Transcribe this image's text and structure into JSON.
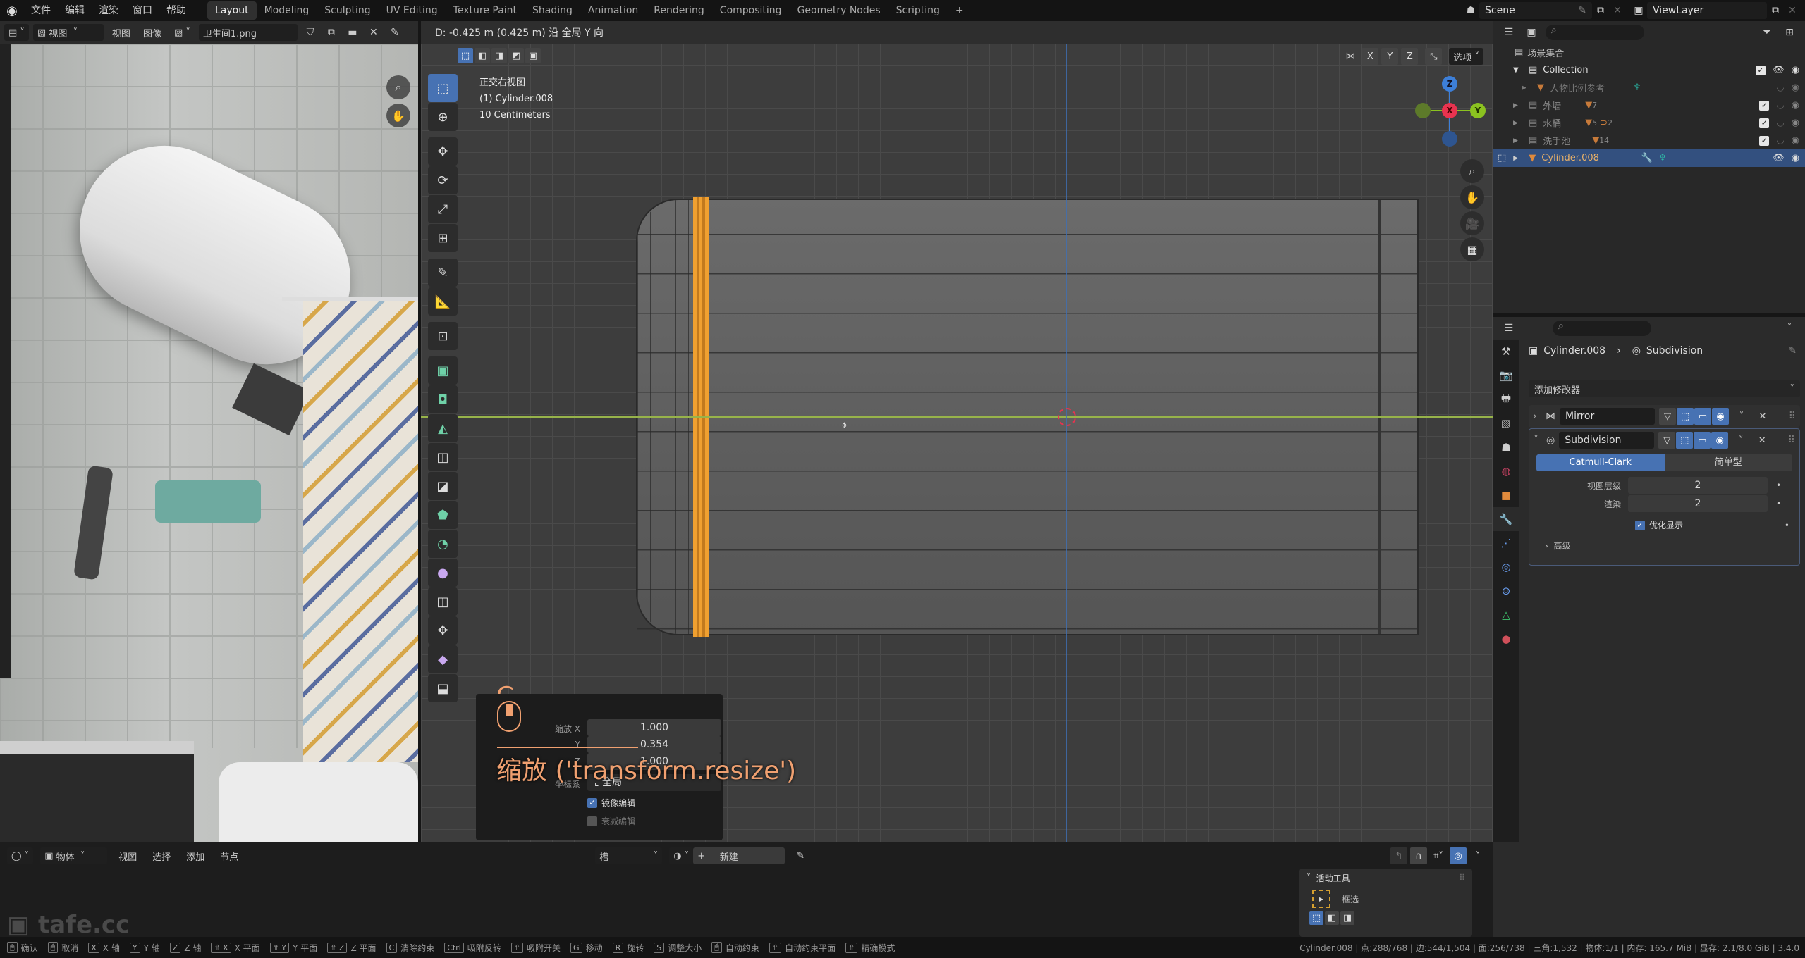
{
  "topbar": {
    "menus": [
      "文件",
      "编辑",
      "渲染",
      "窗口",
      "帮助"
    ],
    "workspaces": [
      "Layout",
      "Modeling",
      "Sculpting",
      "UV Editing",
      "Texture Paint",
      "Shading",
      "Animation",
      "Rendering",
      "Compositing",
      "Geometry Nodes",
      "Scripting"
    ],
    "active_workspace": "Layout",
    "add_workspace": "+",
    "scene": "Scene",
    "view_layer": "ViewLayer"
  },
  "image_editor": {
    "mode_label": "视图",
    "menus": [
      "视图",
      "图像"
    ],
    "image_name": "卫生间1.png"
  },
  "viewport": {
    "header_text": "D: -0.425 m (0.425 m) 沿 全局 Y 向",
    "info_lines": [
      "正交右视图",
      "(1) Cylinder.008",
      "10 Centimeters"
    ],
    "axis_toggles": [
      "X",
      "Y",
      "Z"
    ],
    "options_label": "选项",
    "gizmo": {
      "top": "Z",
      "center": "X",
      "right": "Y"
    },
    "operator": {
      "key_hint": "G",
      "caption": "缩放 ('transform.resize')",
      "fields": [
        {
          "label": "缩放 X",
          "value": "1.000"
        },
        {
          "label": "Y",
          "value": "0.354"
        },
        {
          "label": "Z",
          "value": "1.000"
        }
      ],
      "orient_label": "坐标系",
      "orient_value": "全局",
      "checkboxes": [
        {
          "label": "镜像编辑",
          "checked": true
        },
        {
          "label": "衰减编辑",
          "checked": false
        }
      ]
    }
  },
  "outliner": {
    "root": "场景集合",
    "rows": [
      {
        "name": "Collection",
        "type": "collection",
        "expanded": true
      },
      {
        "name": "人物比例参考",
        "type": "object",
        "hidden": true
      },
      {
        "name": "外墙",
        "type": "collection",
        "badge": "7"
      },
      {
        "name": "水桶",
        "type": "collection",
        "badge": "5",
        "badge2": "2"
      },
      {
        "name": "洗手池",
        "type": "collection",
        "badge": "14"
      },
      {
        "name": "Cylinder.008",
        "type": "object",
        "selected": true
      }
    ]
  },
  "properties": {
    "breadcrumb_object": "Cylinder.008",
    "breadcrumb_modifier": "Subdivision",
    "add_modifier": "添加修改器",
    "modifiers": [
      {
        "name": "Mirror",
        "expanded": false
      },
      {
        "name": "Subdivision",
        "expanded": true
      }
    ],
    "subdiv_types": [
      "Catmull-Clark",
      "简单型"
    ],
    "active_type": "Catmull-Clark",
    "levels_viewport_label": "视图层级",
    "levels_viewport": "2",
    "render_label": "渲染",
    "render_levels": "2",
    "optimal_display_label": "优化显示",
    "optimal_display": true,
    "advanced_label": "高级"
  },
  "timeline": {
    "editor_mode": "物体",
    "menus": [
      "视图",
      "选择",
      "添加",
      "节点"
    ],
    "slot_label": "槽",
    "new_label": "新建",
    "active_tool_title": "活动工具",
    "active_tool_name": "框选"
  },
  "status": {
    "hints": [
      {
        "key": "",
        "label": "确认"
      },
      {
        "key": "",
        "label": "取消"
      },
      {
        "key": "X",
        "label": "X 轴"
      },
      {
        "key": "Y",
        "label": "Y 轴"
      },
      {
        "key": "Z",
        "label": "Z 轴"
      },
      {
        "key": "⇧ X",
        "label": "X 平面"
      },
      {
        "key": "⇧ Y",
        "label": "Y 平面"
      },
      {
        "key": "⇧ Z",
        "label": "Z 平面"
      },
      {
        "key": "C",
        "label": "清除约束"
      },
      {
        "key": "Ctrl",
        "label": "吸附反转"
      },
      {
        "key": "⇧",
        "label": "吸附开关"
      },
      {
        "key": "G",
        "label": "移动"
      },
      {
        "key": "R",
        "label": "旋转"
      },
      {
        "key": "S",
        "label": "调整大小"
      },
      {
        "key": "",
        "label": "自动约束"
      },
      {
        "key": "⇧",
        "label": "自动约束平面"
      },
      {
        "key": "⇧",
        "label": "精确模式"
      }
    ],
    "stats": "Cylinder.008 | 点:288/768 | 边:544/1,504 | 面:256/738 | 三角:1,532 | 物体:1/1 | 内存: 165.7 MiB | 显存: 2.1/8.0 GiB | 3.4.0"
  },
  "watermark": "tafe.cc",
  "colors": {
    "accent": "#4772b3",
    "selection_orange": "#f0a030",
    "selected_row": "#33507f",
    "axis_x": "#e8334f",
    "axis_y": "#8bc220",
    "axis_z": "#3d7fd8"
  }
}
